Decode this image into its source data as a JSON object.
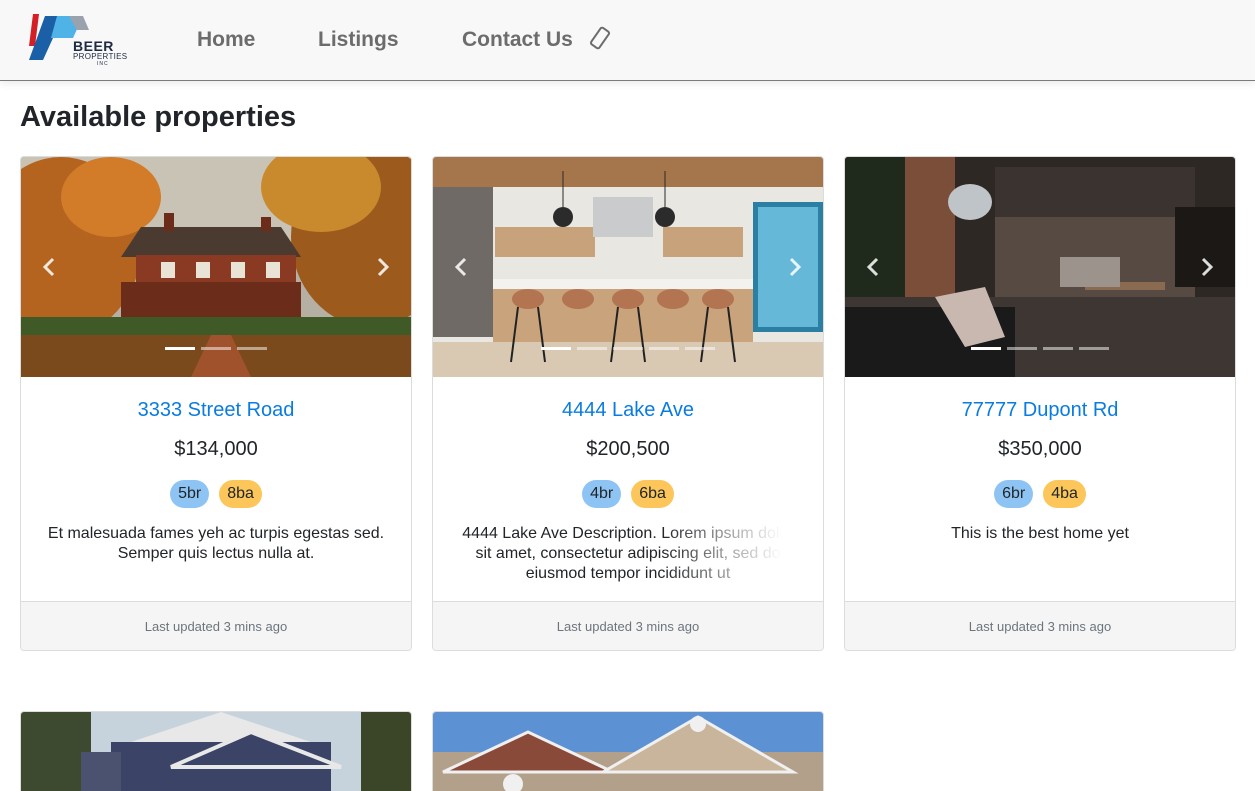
{
  "brand": {
    "name": "BEER",
    "sub": "PROPERTIES",
    "suffix": "INC"
  },
  "nav": {
    "home": "Home",
    "listings": "Listings",
    "contact": "Contact Us"
  },
  "page": {
    "title": "Available properties"
  },
  "colors": {
    "link": "#0a7ce0",
    "badge_br": "#8ec4f4",
    "badge_ba": "#fdc65a",
    "logo_red": "#d32027",
    "logo_blue": "#1b5fa7",
    "logo_lightblue": "#4fb3e8"
  },
  "listings": [
    {
      "address": "3333 Street Road",
      "price": "$134,000",
      "beds": "5br",
      "baths": "8ba",
      "description": "Et malesuada fames yeh ac turpis egestas sed. Semper quis lectus nulla at.",
      "updated": "Last updated 3 mins ago"
    },
    {
      "address": "4444 Lake Ave",
      "price": "$200,500",
      "beds": "4br",
      "baths": "6ba",
      "description": "4444 Lake Ave Description. Lorem ipsum dolor sit amet, consectetur adipiscing elit, sed do eiusmod tempor incididunt ut",
      "updated": "Last updated 3 mins ago"
    },
    {
      "address": "77777 Dupont Rd",
      "price": "$350,000",
      "beds": "6br",
      "baths": "4ba",
      "description": "This is the best home yet",
      "updated": "Last updated 3 mins ago"
    }
  ]
}
